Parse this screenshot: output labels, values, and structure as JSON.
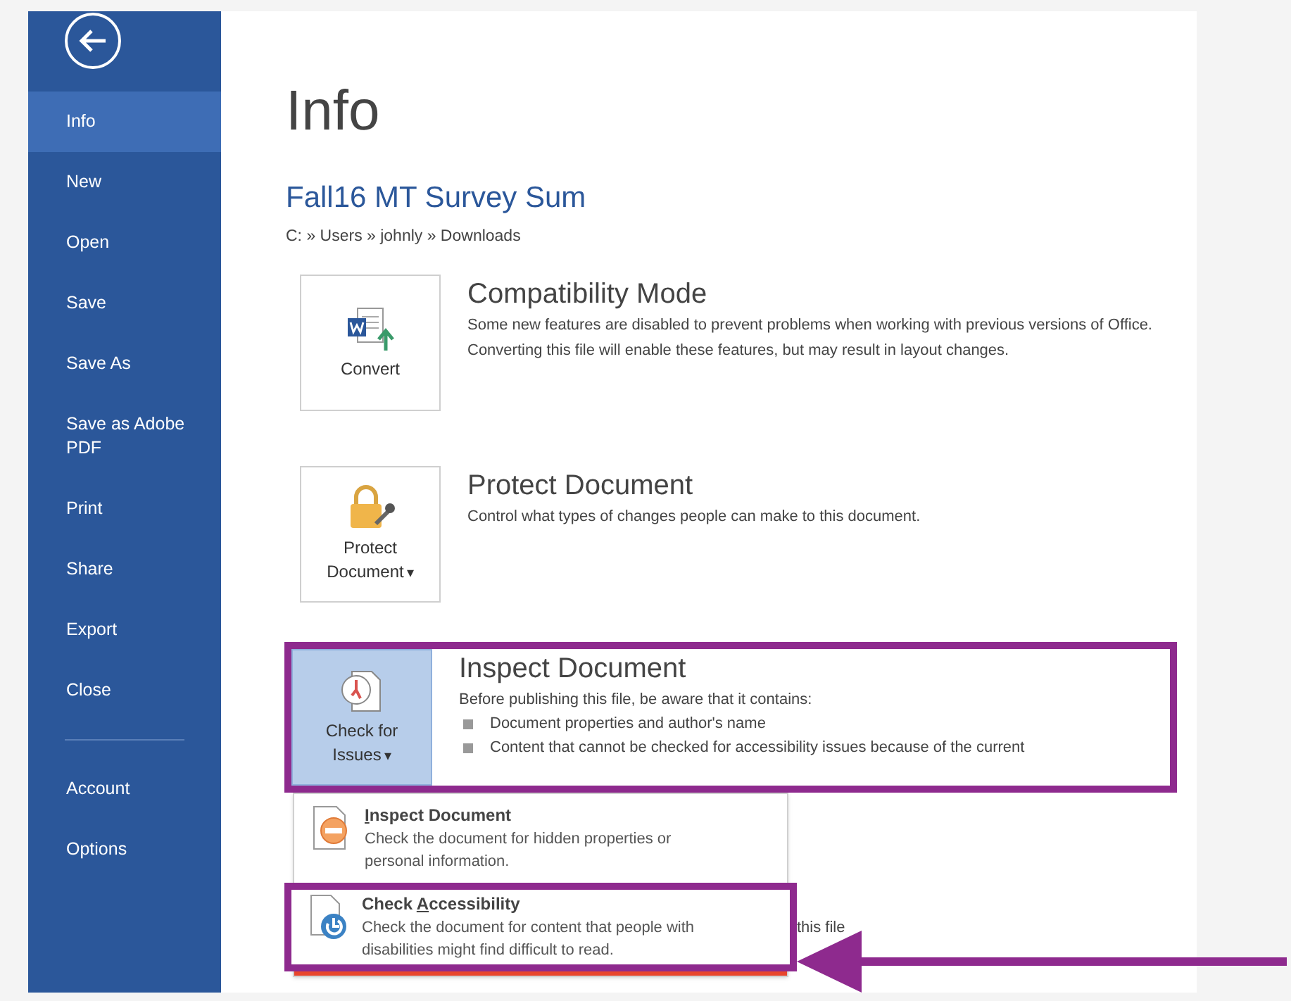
{
  "sidebar": {
    "items": [
      {
        "label": "Info",
        "selected": true
      },
      {
        "label": "New",
        "selected": false
      },
      {
        "label": "Open",
        "selected": false
      },
      {
        "label": "Save",
        "selected": false
      },
      {
        "label": "Save As",
        "selected": false
      },
      {
        "label": "Save as Adobe PDF",
        "selected": false
      },
      {
        "label": "Print",
        "selected": false
      },
      {
        "label": "Share",
        "selected": false
      },
      {
        "label": "Export",
        "selected": false
      },
      {
        "label": "Close",
        "selected": false
      }
    ],
    "bottom_items": [
      {
        "label": "Account",
        "selected": false
      },
      {
        "label": "Options",
        "selected": false
      }
    ]
  },
  "page": {
    "title": "Info",
    "document_title": "Fall16 MT Survey Sum",
    "path": "C: » Users » johnly » Downloads",
    "sections": [
      {
        "kind": "convert",
        "button_label": "Convert",
        "selected": false,
        "annotated": false,
        "heading": "Compatibility Mode",
        "description": "Some new features are disabled to prevent problems when working with previous versions of Office. Converting this file will enable these features, but may result in layout changes."
      },
      {
        "kind": "protect",
        "button_label": "Protect Document",
        "caret": "▾",
        "selected": false,
        "annotated": false,
        "heading": "Protect Document",
        "description": "Control what types of changes people can make to this document."
      },
      {
        "kind": "inspect",
        "button_label": "Check for Issues",
        "caret": "▾",
        "selected": true,
        "annotated": true,
        "heading": "Inspect Document",
        "description": "Before publishing this file, be aware that it contains:",
        "bullets": [
          "Document properties and author's name",
          "Content that cannot be checked for accessibility issues because of the current"
        ]
      }
    ],
    "hidden_text": "this file",
    "menu": {
      "items": [
        {
          "kind": "inspect",
          "annotated": false,
          "access_key": "I",
          "title_rest": "nspect Document",
          "description": "Check the document for hidden properties or personal information."
        },
        {
          "kind": "accessibility",
          "annotated": true,
          "title_prefix": "Check ",
          "access_key": "A",
          "title_rest": "ccessibility",
          "description": "Check the document for content that people with disabilities might find difficult to read."
        }
      ]
    }
  }
}
